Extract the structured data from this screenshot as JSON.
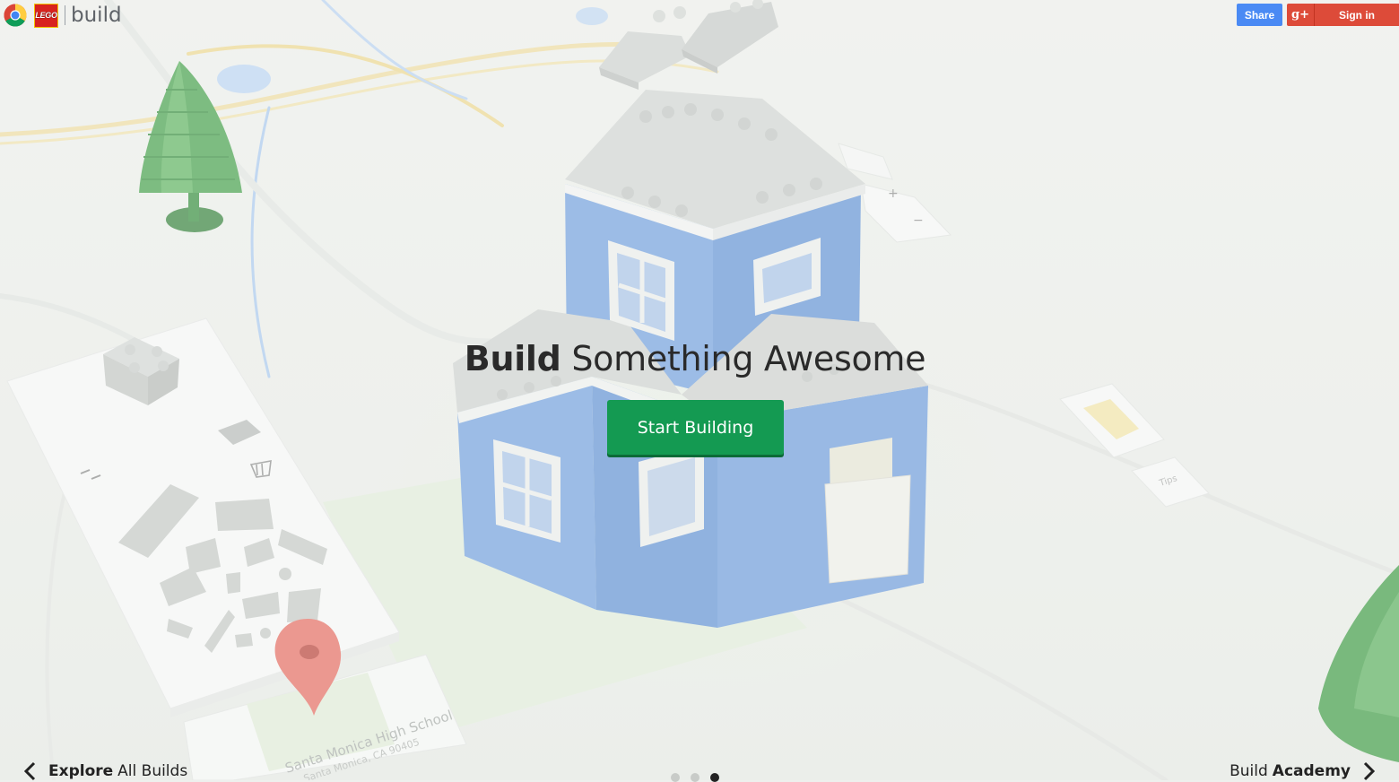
{
  "header": {
    "brand_word": "build",
    "lego_logo_text": "LEGO",
    "share_label": "Share",
    "gplus_label": "g+",
    "signin_label": "Sign in"
  },
  "hero": {
    "title_bold": "Build",
    "title_rest": "Something Awesome",
    "cta_label": "Start Building"
  },
  "footer": {
    "explore_bold": "Explore",
    "explore_rest": "All Builds",
    "academy_pre": "Build",
    "academy_bold": "Academy",
    "pager_count": 3,
    "pager_active": 3
  },
  "scene": {
    "map_pin_caption": "Santa Monica High School",
    "map_pin_address": "Santa Monica, CA 90405",
    "tips_label": "Tips",
    "zoom_plus": "+",
    "zoom_minus": "−"
  },
  "colors": {
    "share_blue": "#4a8af4",
    "gplus_red": "#dd4b39",
    "cta_green": "#149a52",
    "house_blue": "#6f9fe0",
    "brick_grey": "#c9cccb",
    "tree_green": "#3a9a3f",
    "pin_red": "#e5584c"
  }
}
